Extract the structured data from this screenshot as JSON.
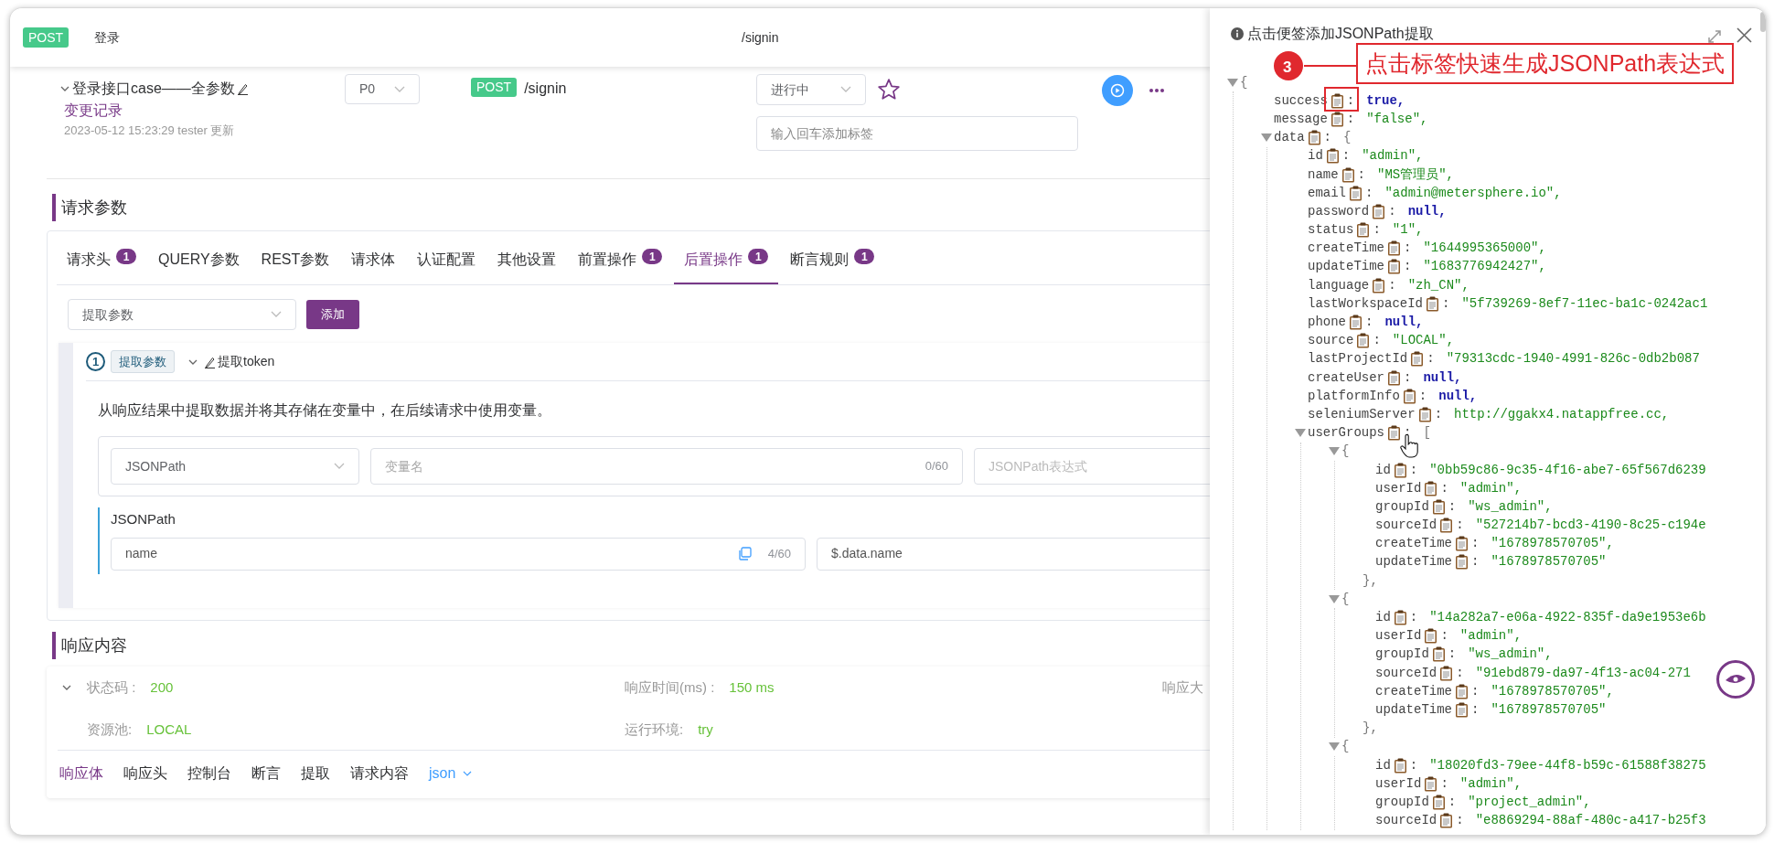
{
  "header": {
    "method": "POST",
    "name": "登录",
    "path": "/signin"
  },
  "case": {
    "title": "登录接口case——全参数",
    "expanded": true,
    "link": "变更记录",
    "updated": "2023-05-12 15:23:29 tester 更新",
    "priority": "P0",
    "method": "POST",
    "path": "/signin",
    "status": "进行中",
    "starred": false,
    "tag_placeholder": "输入回车添加标签"
  },
  "request": {
    "title": "请求参数",
    "tabs": [
      {
        "label": "请求头",
        "count": "1",
        "selected": false
      },
      {
        "label": "QUERY参数",
        "selected": false
      },
      {
        "label": "REST参数",
        "selected": false
      },
      {
        "label": "请求体",
        "selected": false
      },
      {
        "label": "认证配置",
        "selected": false
      },
      {
        "label": "其他设置",
        "selected": false
      },
      {
        "label": "前置操作",
        "count": "1",
        "selected": false
      },
      {
        "label": "后置操作",
        "count": "1",
        "selected": true
      },
      {
        "label": "断言规则",
        "count": "1",
        "selected": false
      }
    ],
    "type_select": "提取参数",
    "add_button": "添加",
    "extractor": {
      "index": "1",
      "tag": "提取参数",
      "expanded": true,
      "name": "提取token",
      "description": "从响应结果中提取数据并将其存储在变量中，在后续请求中使用变量。",
      "mode": "JSONPath",
      "variable_placeholder": "变量名",
      "variable_count": "0/60",
      "expression_placeholder": "JSONPath表达式",
      "jsonpath": {
        "label": "JSONPath",
        "variable": "name",
        "variable_count": "4/60",
        "expression": "$.data.name"
      }
    }
  },
  "response": {
    "title": "响应内容",
    "expanded": true,
    "fields": [
      {
        "label": "状态码 :",
        "value": "200"
      },
      {
        "label": "响应时间(ms) :",
        "value": "150 ms"
      },
      {
        "label": "响应大"
      },
      {
        "label": "资源池:",
        "value": "LOCAL"
      },
      {
        "label": "运行环境:",
        "value": "try"
      }
    ],
    "tabs": [
      {
        "label": "响应体",
        "selected": true
      },
      {
        "label": "响应头",
        "selected": false
      },
      {
        "label": "控制台",
        "selected": false
      },
      {
        "label": "断言",
        "selected": false
      },
      {
        "label": "提取",
        "selected": false
      },
      {
        "label": "请求内容",
        "selected": false
      }
    ],
    "format": "json"
  },
  "panel": {
    "title": "点击便签添加JSONPath提取",
    "annotation": {
      "number": "3",
      "text": "点击标签快速生成JSONPath表达式"
    },
    "tree": {
      "open": "{",
      "expanded": true,
      "children": [
        {
          "key": "success",
          "sep": ":",
          "value": "true,",
          "kind": "literal"
        },
        {
          "key": "message",
          "sep": ":",
          "value": "\"false\",",
          "kind": "string"
        },
        {
          "key": "data",
          "sep": ":",
          "open": "{",
          "expanded": true,
          "children": [
            {
              "key": "id",
              "sep": ":",
              "value": "\"admin\",",
              "kind": "string"
            },
            {
              "key": "name",
              "sep": ":",
              "value": "\"MS管理员\",",
              "kind": "string"
            },
            {
              "key": "email",
              "sep": ":",
              "value": "\"admin@metersphere.io\",",
              "kind": "string"
            },
            {
              "key": "password",
              "sep": ":",
              "value": "null,",
              "kind": "literal"
            },
            {
              "key": "status",
              "sep": ":",
              "value": "\"1\",",
              "kind": "string"
            },
            {
              "key": "createTime",
              "sep": ":",
              "value": "\"1644995365000\",",
              "kind": "string"
            },
            {
              "key": "updateTime",
              "sep": ":",
              "value": "\"1683776942427\",",
              "kind": "string"
            },
            {
              "key": "language",
              "sep": ":",
              "value": "\"zh_CN\",",
              "kind": "string"
            },
            {
              "key": "lastWorkspaceId",
              "sep": ":",
              "value": "\"5f739269-8ef7-11ec-ba1c-0242ac1",
              "kind": "string"
            },
            {
              "key": "phone",
              "sep": ":",
              "value": "null,",
              "kind": "literal"
            },
            {
              "key": "source",
              "sep": ":",
              "value": "\"LOCAL\",",
              "kind": "string"
            },
            {
              "key": "lastProjectId",
              "sep": ":",
              "value": "\"79313cdc-1940-4991-826c-0db2b087",
              "kind": "string"
            },
            {
              "key": "createUser",
              "sep": ":",
              "value": "null,",
              "kind": "literal"
            },
            {
              "key": "platformInfo",
              "sep": ":",
              "value": "null,",
              "kind": "literal"
            },
            {
              "key": "seleniumServer",
              "sep": ":",
              "value": "http://ggakx4.natappfree.cc,",
              "kind": "string"
            },
            {
              "key": "userGroups",
              "sep": ":",
              "open": "[",
              "expanded": true,
              "children": [
                {
                  "open": "{",
                  "expanded": true,
                  "close": "},",
                  "children": [
                    {
                      "key": "id",
                      "sep": ":",
                      "value": "\"0bb59c86-9c35-4f16-abe7-65f567d6239",
                      "kind": "string"
                    },
                    {
                      "key": "userId",
                      "sep": ":",
                      "value": "\"admin\",",
                      "kind": "string"
                    },
                    {
                      "key": "groupId",
                      "sep": ":",
                      "value": "\"ws_admin\",",
                      "kind": "string"
                    },
                    {
                      "key": "sourceId",
                      "sep": ":",
                      "value": "\"527214b7-bcd3-4190-8c25-c194e",
                      "kind": "string"
                    },
                    {
                      "key": "createTime",
                      "sep": ":",
                      "value": "\"1678978570705\",",
                      "kind": "string"
                    },
                    {
                      "key": "updateTime",
                      "sep": ":",
                      "value": "\"1678978570705\"",
                      "kind": "string"
                    }
                  ]
                },
                {
                  "open": "{",
                  "expanded": true,
                  "close": "},",
                  "children": [
                    {
                      "key": "id",
                      "sep": ":",
                      "value": "\"14a282a7-e06a-4922-835f-da9e1953e6b",
                      "kind": "string"
                    },
                    {
                      "key": "userId",
                      "sep": ":",
                      "value": "\"admin\",",
                      "kind": "string"
                    },
                    {
                      "key": "groupId",
                      "sep": ":",
                      "value": "\"ws_admin\",",
                      "kind": "string"
                    },
                    {
                      "key": "sourceId",
                      "sep": ":",
                      "value": "\"91ebd879-da97-4f13-ac04-271",
                      "kind": "string"
                    },
                    {
                      "key": "createTime",
                      "sep": ":",
                      "value": "\"1678978570705\",",
                      "kind": "string"
                    },
                    {
                      "key": "updateTime",
                      "sep": ":",
                      "value": "\"1678978570705\"",
                      "kind": "string"
                    }
                  ]
                },
                {
                  "open": "{",
                  "expanded": true,
                  "children": [
                    {
                      "key": "id",
                      "sep": ":",
                      "value": "\"18020fd3-79ee-44f8-b59c-61588f38275",
                      "kind": "string"
                    },
                    {
                      "key": "userId",
                      "sep": ":",
                      "value": "\"admin\",",
                      "kind": "string"
                    },
                    {
                      "key": "groupId",
                      "sep": ":",
                      "value": "\"project_admin\",",
                      "kind": "string"
                    },
                    {
                      "key": "sourceId",
                      "sep": ":",
                      "value": "\"e8869294-88af-480c-a417-b25f3",
                      "kind": "string"
                    }
                  ]
                }
              ]
            }
          ]
        }
      ]
    }
  }
}
